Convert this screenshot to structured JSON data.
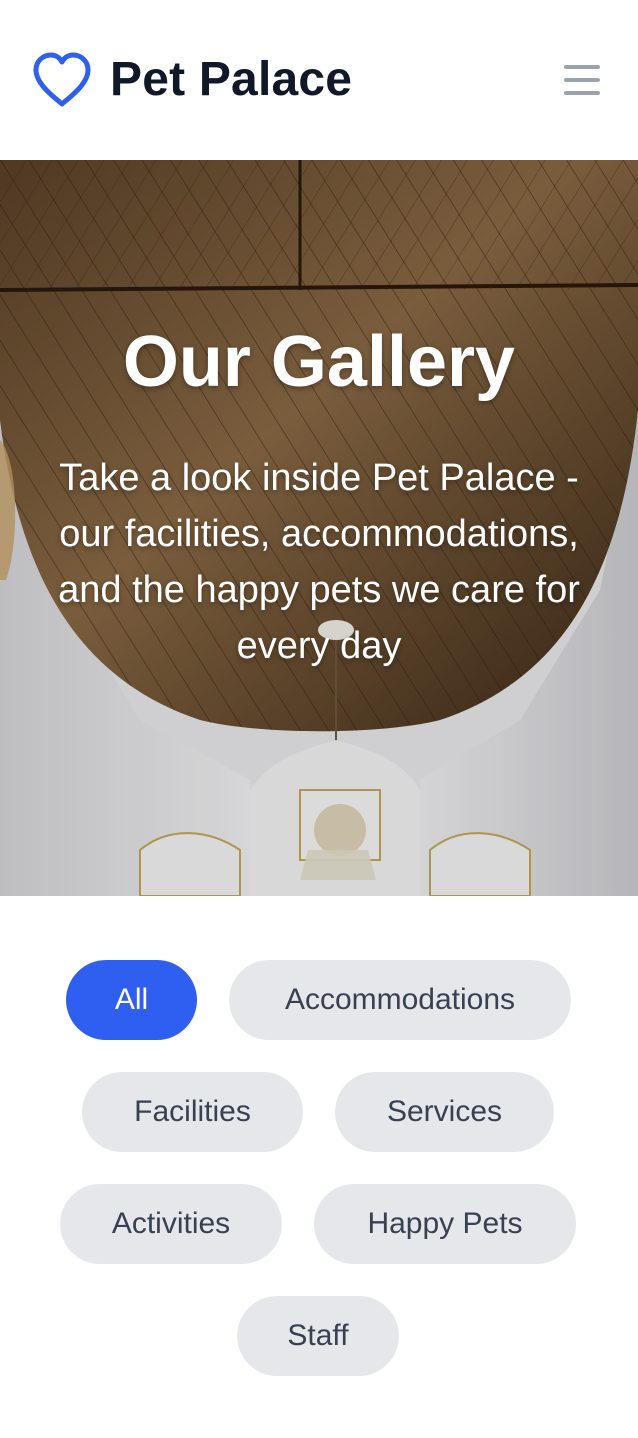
{
  "header": {
    "brand": "Pet Palace",
    "logo_icon": "heart-icon",
    "menu_icon": "hamburger-menu-icon",
    "brand_color": "#2f5ff0"
  },
  "hero": {
    "title": "Our Gallery",
    "subtitle": "Take a look inside Pet Palace - our facilities, accommodations, and the happy pets we care for every day",
    "background": "interior-ceiling-photo"
  },
  "filters": {
    "active_color": "#2f5ff0",
    "inactive_color": "#e5e7eb",
    "items": [
      {
        "label": "All",
        "active": true
      },
      {
        "label": "Accommodations",
        "active": false
      },
      {
        "label": "Facilities",
        "active": false
      },
      {
        "label": "Services",
        "active": false
      },
      {
        "label": "Activities",
        "active": false
      },
      {
        "label": "Happy Pets",
        "active": false
      },
      {
        "label": "Staff",
        "active": false
      }
    ]
  }
}
